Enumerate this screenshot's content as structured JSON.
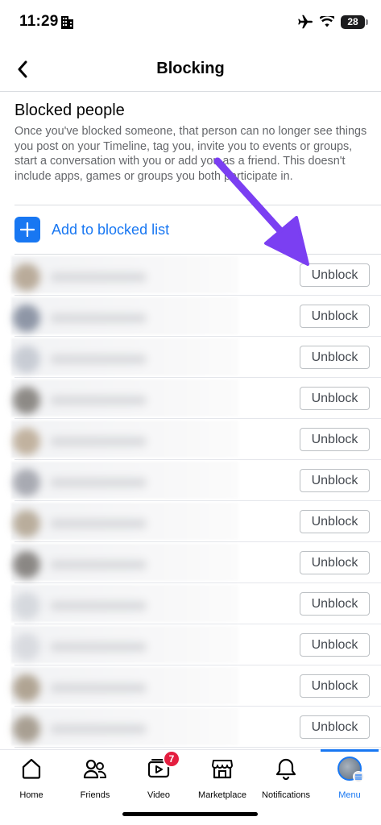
{
  "status_bar": {
    "time": "11:29",
    "battery": "28"
  },
  "header": {
    "title": "Blocking"
  },
  "blocked_section": {
    "title": "Blocked people",
    "description": "Once you've blocked someone, that person can no longer see things you post on your Timeline, tag you, invite you to events or groups, start a conversation with you or add you as a friend. This doesn't include apps, games or groups you both participate in.",
    "add_label": "Add to blocked list"
  },
  "blocked_people": [
    {
      "unblock_label": "Unblock",
      "avatar_tone": "#b9ab9a"
    },
    {
      "unblock_label": "Unblock",
      "avatar_tone": "#8e96a6"
    },
    {
      "unblock_label": "Unblock",
      "avatar_tone": "#c8ccd4"
    },
    {
      "unblock_label": "Unblock",
      "avatar_tone": "#8d8a86"
    },
    {
      "unblock_label": "Unblock",
      "avatar_tone": "#c1b29f"
    },
    {
      "unblock_label": "Unblock",
      "avatar_tone": "#a8aab2"
    },
    {
      "unblock_label": "Unblock",
      "avatar_tone": "#b9ad9c"
    },
    {
      "unblock_label": "Unblock",
      "avatar_tone": "#8a8784"
    },
    {
      "unblock_label": "Unblock",
      "avatar_tone": "#d6d9de"
    },
    {
      "unblock_label": "Unblock",
      "avatar_tone": "#d9dbe0"
    },
    {
      "unblock_label": "Unblock",
      "avatar_tone": "#b0a493"
    },
    {
      "unblock_label": "Unblock",
      "avatar_tone": "#a89f92"
    }
  ],
  "tabs": [
    {
      "label": "Home",
      "icon": "home-icon"
    },
    {
      "label": "Friends",
      "icon": "friends-icon"
    },
    {
      "label": "Video",
      "icon": "video-icon",
      "badge": "7"
    },
    {
      "label": "Marketplace",
      "icon": "marketplace-icon"
    },
    {
      "label": "Notifications",
      "icon": "bell-icon"
    },
    {
      "label": "Menu",
      "icon": "menu-avatar",
      "active": true
    }
  ],
  "colors": {
    "accent": "#1877f2",
    "annotation_arrow": "#7b3ff2",
    "badge": "#e41e3f"
  }
}
